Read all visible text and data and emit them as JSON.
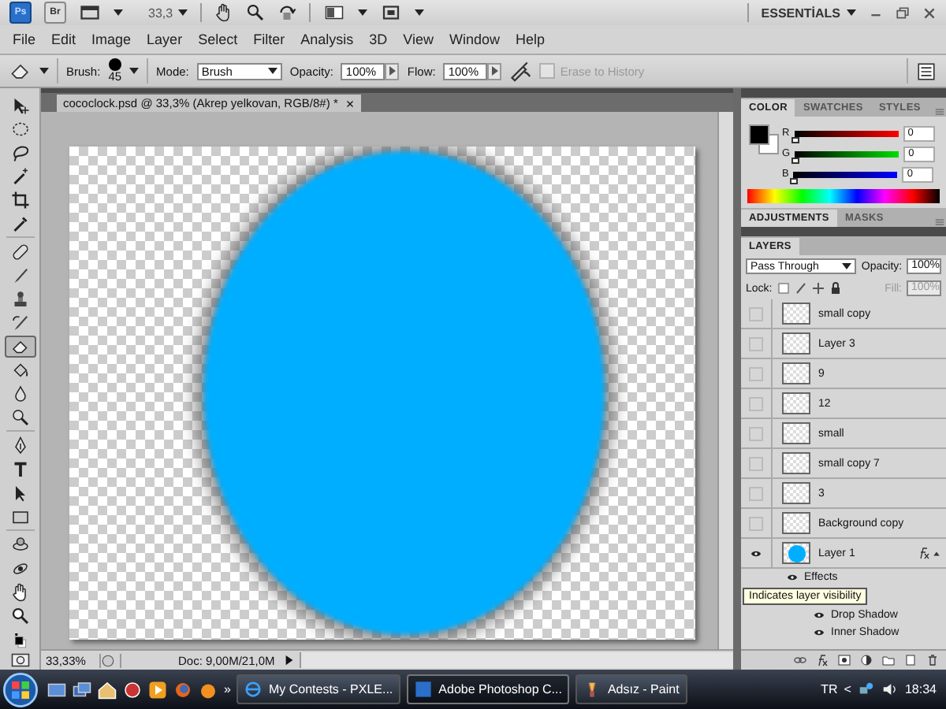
{
  "app_bar": {
    "logo": "Ps",
    "bridge": "Br",
    "zoom": "33,3",
    "workspace": "ESSENTİALS"
  },
  "menu": [
    "File",
    "Edit",
    "Image",
    "Layer",
    "Select",
    "Filter",
    "Analysis",
    "3D",
    "View",
    "Window",
    "Help"
  ],
  "options_bar": {
    "brush_label": "Brush:",
    "brush_size": "45",
    "mode_label": "Mode:",
    "mode": "Brush",
    "opacity_label": "Opacity:",
    "opacity": "100%",
    "flow_label": "Flow:",
    "flow": "100%",
    "erase_to_history": {
      "label": "Erase to History",
      "checked": false,
      "disabled": true
    }
  },
  "tools": [
    {
      "kind": "move",
      "selected": false
    },
    {
      "kind": "marquee",
      "selected": false
    },
    {
      "kind": "lasso",
      "selected": false
    },
    {
      "kind": "wand",
      "selected": false
    },
    {
      "kind": "crop",
      "selected": false
    },
    {
      "kind": "eyedropper",
      "selected": false
    },
    {
      "kind": "healing",
      "selected": false
    },
    {
      "kind": "brush",
      "selected": false
    },
    {
      "kind": "stamp",
      "selected": false
    },
    {
      "kind": "history",
      "selected": false
    },
    {
      "kind": "eraser",
      "selected": true
    },
    {
      "kind": "bucket",
      "selected": false
    },
    {
      "kind": "blur",
      "selected": false
    },
    {
      "kind": "dodge",
      "selected": false
    },
    {
      "kind": "pen",
      "selected": false
    },
    {
      "kind": "type",
      "selected": false
    },
    {
      "kind": "pointer",
      "selected": false
    },
    {
      "kind": "shape",
      "selected": false
    },
    {
      "kind": "rotate",
      "selected": false
    },
    {
      "kind": "orbit",
      "selected": false
    },
    {
      "kind": "hand",
      "selected": false
    },
    {
      "kind": "zoom",
      "selected": false
    }
  ],
  "document_tab": {
    "title": "cococlock.psd @ 33,3% (Akrep yelkovan, RGB/8#) *",
    "close": "×"
  },
  "status_bar": {
    "zoom": "33,33%",
    "doc": "Doc: 9,00M/21,0M"
  },
  "color_panel": {
    "tabs": [
      {
        "label": "COLOR",
        "selected": true
      },
      {
        "label": "SWATCHES",
        "selected": false
      },
      {
        "label": "STYLES",
        "selected": false
      }
    ],
    "channels": [
      {
        "name": "R",
        "value": "0",
        "level": 0
      },
      {
        "name": "G",
        "value": "0",
        "level": 0
      },
      {
        "name": "B",
        "value": "0",
        "level": 0
      }
    ]
  },
  "adjustments_panel": {
    "tabs": [
      {
        "label": "ADJUSTMENTS",
        "selected": true
      },
      {
        "label": "MASKS",
        "selected": false
      }
    ]
  },
  "layers_panel": {
    "tabs": [
      {
        "label": "LAYERS",
        "selected": true
      }
    ],
    "blend_mode": "Pass Through",
    "opacity_label": "Opacity:",
    "opacity": "100%",
    "lock_label": "Lock:",
    "fill_label": "Fill:",
    "fill": "100%",
    "layers": [
      {
        "name": "small copy",
        "visible": false,
        "selected": false,
        "kind": "transparent",
        "fx": false
      },
      {
        "name": "Layer 3",
        "visible": false,
        "selected": false,
        "kind": "transparent",
        "fx": false
      },
      {
        "name": "9",
        "visible": false,
        "selected": false,
        "kind": "transparent",
        "fx": false
      },
      {
        "name": "12",
        "visible": false,
        "selected": false,
        "kind": "transparent",
        "fx": false
      },
      {
        "name": "small",
        "visible": false,
        "selected": false,
        "kind": "transparent",
        "fx": false
      },
      {
        "name": "small copy 7",
        "visible": false,
        "selected": false,
        "kind": "transparent",
        "fx": false
      },
      {
        "name": "3",
        "visible": false,
        "selected": false,
        "kind": "transparent",
        "fx": false
      },
      {
        "name": "Background copy",
        "visible": false,
        "selected": false,
        "kind": "transparent",
        "fx": false
      },
      {
        "name": "Layer 1",
        "visible": true,
        "selected": false,
        "kind": "circle",
        "fx": true,
        "expanded": true
      }
    ],
    "effects": {
      "label": "Effects",
      "items": [
        "Drop Shadow",
        "Inner Shadow"
      ]
    },
    "tooltip": "Indicates layer visibility"
  },
  "taskbar": {
    "more": "»",
    "buttons": [
      {
        "label": "My Contests - PXLE...",
        "kind": "browser",
        "selected": false
      },
      {
        "label": "Adobe Photoshop C...",
        "kind": "photoshop",
        "selected": true
      },
      {
        "label": "Adsız - Paint",
        "kind": "paint",
        "selected": false
      }
    ],
    "language": "TR",
    "tray_expand": "<",
    "time": "18:34"
  }
}
